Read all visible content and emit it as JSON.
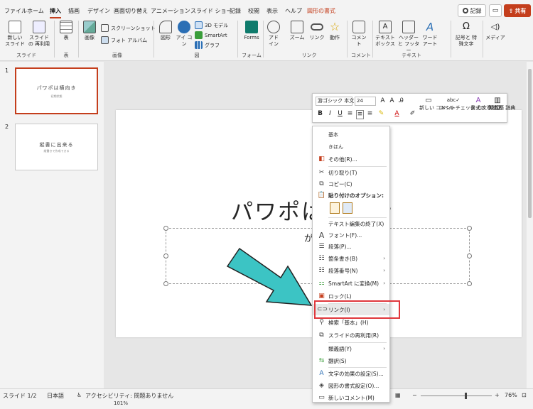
{
  "tabs": [
    "ファイル",
    "ホーム",
    "挿入",
    "描画",
    "デザイン",
    "画面切り替え",
    "アニメーション",
    "スライド ショー",
    "記録",
    "校閲",
    "表示",
    "ヘルプ",
    "図形の書式"
  ],
  "active_tab": "挿入",
  "record_label": "記録",
  "share_label": "共有",
  "ribbon": {
    "buttons": [
      {
        "label": "新しい スライド",
        "icon": "new-slide-icon"
      },
      {
        "label": "スライドの 再利用",
        "icon": "reuse-slide-icon"
      },
      {
        "label": "表",
        "icon": "table-icon"
      },
      {
        "label": "画像",
        "icon": "image-icon"
      },
      {
        "label": "図形",
        "icon": "shapes-icon"
      },
      {
        "label": "アイ コン",
        "icon": "icons-icon"
      },
      {
        "label": "Forms",
        "icon": "forms-icon"
      },
      {
        "label": "アド イン",
        "icon": "addin-icon"
      },
      {
        "label": "ズーム",
        "icon": "zoom-icon"
      },
      {
        "label": "リンク",
        "icon": "link-icon"
      },
      {
        "label": "動作",
        "icon": "action-icon"
      },
      {
        "label": "コメント",
        "icon": "comment-icon"
      },
      {
        "label": "テキスト ボックス",
        "icon": "textbox-icon"
      },
      {
        "label": "ヘッダーと フッター",
        "icon": "header-footer-icon"
      },
      {
        "label": "ワード アート",
        "icon": "wordart-icon"
      },
      {
        "label": "記号と 特殊文字",
        "icon": "symbol-icon"
      },
      {
        "label": "メディア",
        "icon": "media-icon"
      }
    ],
    "small": {
      "screenshot": "スクリーンショット",
      "photo_album": "フォト アルバム",
      "model3d": "3D モデル",
      "smartart": "SmartArt",
      "graph": "グラフ"
    },
    "groups": [
      "スライド",
      "表",
      "画像",
      "図",
      "フォーム",
      "リンク",
      "コメント",
      "テキスト"
    ]
  },
  "thumbnails": [
    {
      "num": "1",
      "title": "パワポは横向き",
      "sub": "初期状態"
    },
    {
      "num": "2",
      "title": "縦書に出来る",
      "sub": "縦書きで作成できる"
    }
  ],
  "slide": {
    "title": "パワポは横向き",
    "subtitle": "が基本"
  },
  "minitoolbar": {
    "font": "游ゴシック 本文",
    "size": "24",
    "new_comment": "新しい コメント",
    "spell": "スペル チェック と文章校正",
    "format_clear": "書式の クリア",
    "thesaurus": "類義語 辞典"
  },
  "context_menu": [
    {
      "label": "基本",
      "icon": "",
      "type": "sm"
    },
    {
      "label": "きほん",
      "icon": "",
      "type": "sm"
    },
    {
      "label": "その他(R)...",
      "icon": "others-icon"
    },
    {
      "label": "切り取り(T)",
      "icon": "scissors-icon"
    },
    {
      "label": "コピー(C)",
      "icon": "copy-icon"
    },
    {
      "label": "貼り付けのオプション:",
      "icon": "paste-icon",
      "type": "bold"
    },
    {
      "label": "テキスト編集の終了(X)",
      "icon": ""
    },
    {
      "label": "フォント(F)...",
      "icon": "font-icon"
    },
    {
      "label": "段落(P)...",
      "icon": "paragraph-icon"
    },
    {
      "label": "箇条書き(B)",
      "icon": "bullets-icon",
      "submenu": true
    },
    {
      "label": "段落番号(N)",
      "icon": "numbering-icon",
      "submenu": true
    },
    {
      "label": "SmartArt に変換(M)",
      "icon": "smartart-icon",
      "submenu": true
    },
    {
      "label": "ロック(L)",
      "icon": "lock-icon"
    },
    {
      "label": "リンク(I)",
      "icon": "link-icon",
      "submenu": true
    },
    {
      "label": "検索「基本」(H)",
      "icon": "search-icon"
    },
    {
      "label": "スライドの再利用(R)",
      "icon": "reuse-icon"
    },
    {
      "label": "類義語(Y)",
      "icon": "",
      "submenu": true
    },
    {
      "label": "翻訳(S)",
      "icon": "translate-icon"
    },
    {
      "label": "文字の効果の設定(S)...",
      "icon": "text-effect-icon"
    },
    {
      "label": "図形の書式設定(O)...",
      "icon": "shape-format-icon"
    },
    {
      "label": "新しいコメント(M)",
      "icon": "new-comment-icon"
    }
  ],
  "statusbar": {
    "slide": "スライド 1/2",
    "lang": "日本語",
    "accessibility": "アクセシビリティ: 問題ありません",
    "zoom": "76%",
    "zoom2": "101%"
  }
}
